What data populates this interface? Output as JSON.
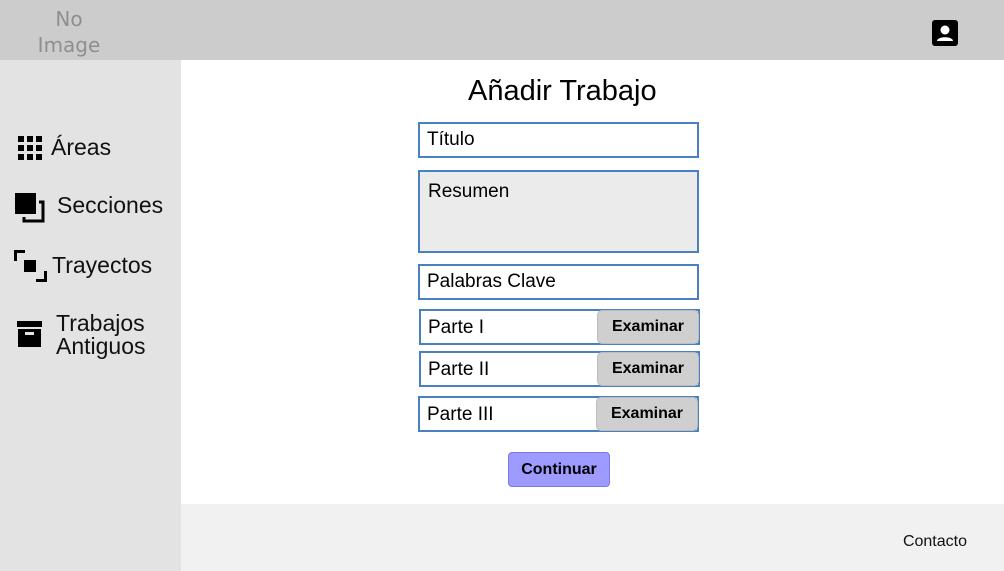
{
  "header": {
    "logo_line1": "No",
    "logo_line2": "Image",
    "user_icon": "account-box-icon"
  },
  "sidebar": {
    "items": [
      {
        "label": "Áreas",
        "icon": "apps-grid-icon"
      },
      {
        "label": "Secciones",
        "icon": "layers-icon"
      },
      {
        "label": "Trayectos",
        "icon": "route-icon"
      },
      {
        "label": "Trabajos Antiguos",
        "label_line1": "Trabajos",
        "label_line2": "Antiguos",
        "icon": "archive-icon"
      }
    ]
  },
  "form": {
    "title": "Añadir Trabajo",
    "titulo_placeholder": "Título",
    "resumen_placeholder": "Resumen",
    "palabras_placeholder": "Palabras Clave",
    "files": [
      {
        "label": "Parte I",
        "button": "Examinar"
      },
      {
        "label": "Parte II",
        "button": "Examinar"
      },
      {
        "label": "Parte III",
        "button": "Examinar"
      }
    ],
    "submit_label": "Continuar"
  },
  "footer": {
    "contact_label": "Contacto"
  },
  "colors": {
    "topbar": "#cccccc",
    "sidebar": "#e3e3e3",
    "footer": "#f1f1f1",
    "field_border": "#4a7fc1",
    "button_gray": "#cfcfcf",
    "accent_button": "#9d9bff"
  }
}
